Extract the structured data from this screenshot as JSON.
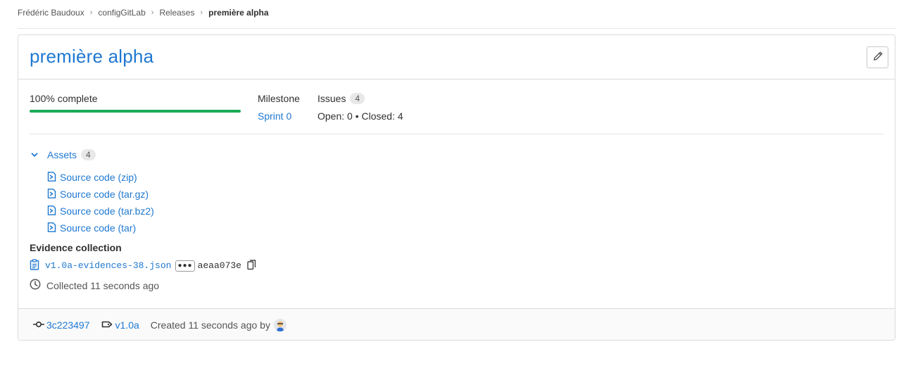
{
  "breadcrumb": {
    "items": [
      "Frédéric Baudoux",
      "configGitLab",
      "Releases"
    ],
    "current": "première alpha"
  },
  "release": {
    "title": "première alpha",
    "progress": {
      "label": "100% complete",
      "percent": 100
    },
    "milestone": {
      "label": "Milestone",
      "value": "Sprint 0"
    },
    "issues": {
      "label": "Issues",
      "count": "4",
      "summary": "Open: 0 • Closed: 4"
    },
    "assets": {
      "label": "Assets",
      "count": "4",
      "items": [
        "Source code (zip)",
        "Source code (tar.gz)",
        "Source code (tar.bz2)",
        "Source code (tar)"
      ]
    },
    "evidence": {
      "title": "Evidence collection",
      "file": "v1.0a-evidences-38.json",
      "sha": "aeaa073e",
      "collected": "Collected 11 seconds ago"
    },
    "footer": {
      "commit": "3c223497",
      "tag": "v1.0a",
      "created": "Created 11 seconds ago by"
    }
  },
  "colors": {
    "link": "#1f78d1",
    "progress": "#1aaa55"
  },
  "icons": [
    "chevron-right-icon",
    "pencil-icon",
    "chevron-down-icon",
    "file-archive-icon",
    "clipboard-icon",
    "ellipsis-icon",
    "copy-icon",
    "clock-icon",
    "commit-icon",
    "tag-icon",
    "avatar"
  ]
}
